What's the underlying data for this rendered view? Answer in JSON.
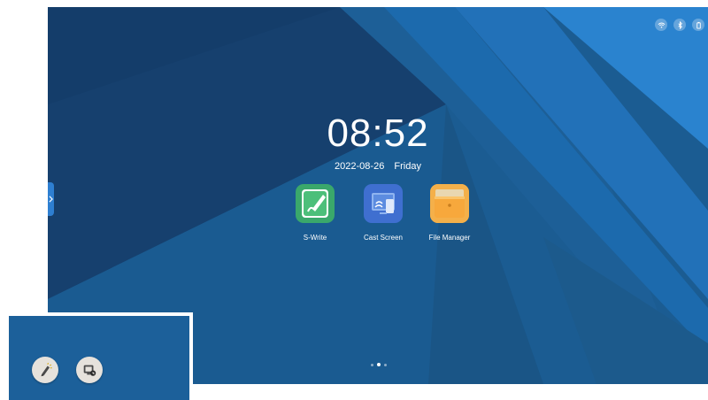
{
  "clock": {
    "time": "08:52",
    "date": "2022-08-26",
    "weekday": "Friday"
  },
  "apps": [
    {
      "label": "S-Write",
      "icon": "pen-notepad-icon"
    },
    {
      "label": "Cast Screen",
      "icon": "cast-screen-icon"
    },
    {
      "label": "File Manager",
      "icon": "folder-icon"
    }
  ],
  "status_bar": {
    "icons": [
      "wifi-icon",
      "bluetooth-icon",
      "usb-icon"
    ]
  },
  "pager": {
    "pages": 3,
    "active": 2
  },
  "tray": {
    "icons": [
      "pen-highlight-icon",
      "screen-record-icon"
    ]
  },
  "colors": {
    "wallpaper_base": "#1a5a8e",
    "accent": "#2e7fd1",
    "swrite_green": "#3aa86b",
    "cast_blue": "#3f6fd0",
    "folder_orange": "#f0a53a"
  }
}
